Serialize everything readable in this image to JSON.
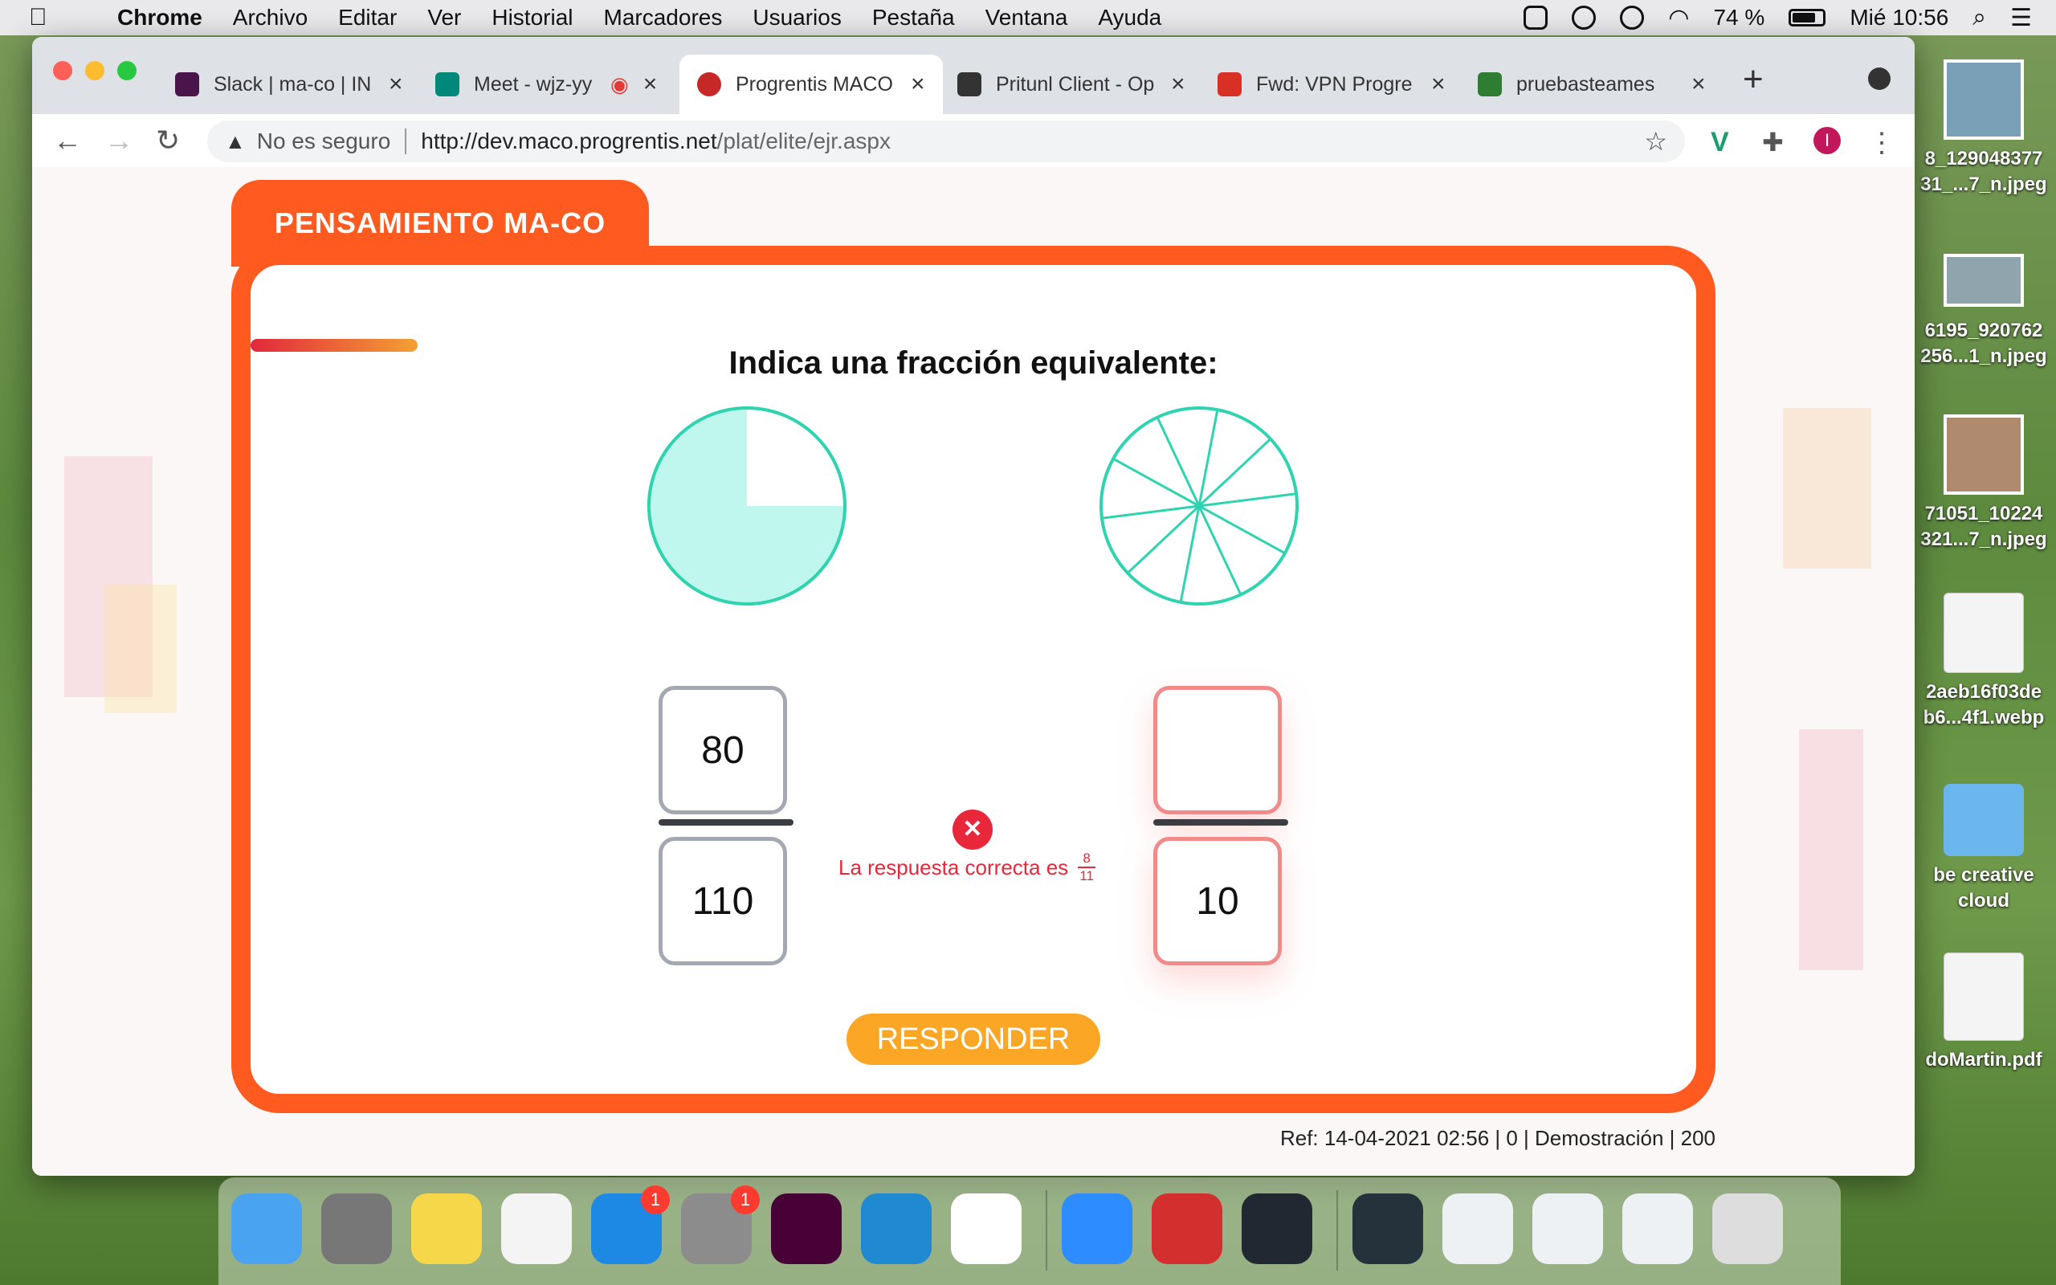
{
  "menubar": {
    "app": "Chrome",
    "items": [
      "Archivo",
      "Editar",
      "Ver",
      "Historial",
      "Marcadores",
      "Usuarios",
      "Pestaña",
      "Ventana",
      "Ayuda"
    ],
    "battery": "74 %",
    "clock": "Mié 10:56"
  },
  "desktop": {
    "files": [
      {
        "label1": "8_129048377",
        "label2": "31_...7_n.jpeg",
        "icon": "photo-icon"
      },
      {
        "label1": "",
        "label2": "",
        "icon": "photo-icon"
      },
      {
        "label1": "6195_920762",
        "label2": "256...1_n.jpeg",
        "icon": "photo-icon"
      },
      {
        "label1": "71051_10224",
        "label2": "321...7_n.jpeg",
        "icon": "photo-icon"
      },
      {
        "label1": "2aeb16f03de",
        "label2": "b6...4f1.webp",
        "icon": "preview-icon"
      },
      {
        "label1": "be creative",
        "label2": "cloud",
        "icon": "folder-icon"
      },
      {
        "label1": "doMartin.pdf",
        "label2": "",
        "icon": "pdf-icon"
      }
    ]
  },
  "browser": {
    "tabs": [
      {
        "label": "Slack | ma-co | IN",
        "color": "#4a154b"
      },
      {
        "label": "Meet - wjz-yy",
        "color": "#00897b"
      },
      {
        "label": "Progrentis MACO",
        "color": "#c62828"
      },
      {
        "label": "Pritunl Client - Op",
        "color": "#333333"
      },
      {
        "label": "Fwd: VPN Progre",
        "color": "#d93025"
      },
      {
        "label": "pruebasteames",
        "color": "#2e7d32"
      }
    ],
    "omnibox": {
      "security": "No es seguro",
      "url_host": "http://dev.maco.progrentis.net",
      "url_path": "/plat/elite/ejr.aspx"
    },
    "profile_initial": "I"
  },
  "exercise": {
    "section_title": "PENSAMIENTO MA-CO",
    "question": "Indica una fracción equivalente:",
    "left_fraction": {
      "numerator": "80",
      "denominator": "110"
    },
    "right_fraction": {
      "numerator": "",
      "denominator": "10"
    },
    "feedback_text": "La respuesta correcta es",
    "correct_answer": {
      "numerator": "8",
      "denominator": "11"
    },
    "left_circle_filled_fraction": 0.75,
    "right_circle_segments": 10,
    "submit_label": "RESPONDER",
    "ref": "Ref: 14-04-2021 02:56 | 0 | Demostración | 200"
  },
  "colors": {
    "accent_orange": "#ff5a1f",
    "button_yellow": "#fba624",
    "error_red": "#e8273a",
    "pie_teal": "#2ed3b0",
    "pie_fill": "#bff7ee"
  },
  "dock": {
    "apps": [
      {
        "name": "finder-icon",
        "color": "#4aa3f0",
        "badge": ""
      },
      {
        "name": "launchpad-icon",
        "color": "#777777",
        "badge": ""
      },
      {
        "name": "notes-icon",
        "color": "#f7d74a",
        "badge": ""
      },
      {
        "name": "reminders-icon",
        "color": "#f4f4f4",
        "badge": ""
      },
      {
        "name": "app-store-icon",
        "color": "#1e88e5",
        "badge": "1"
      },
      {
        "name": "system-preferences-icon",
        "color": "#8c8c8c",
        "badge": "1"
      },
      {
        "name": "adobe-xd-icon",
        "color": "#470137",
        "badge": ""
      },
      {
        "name": "vscode-icon",
        "color": "#1f8ad2",
        "badge": ""
      },
      {
        "name": "chrome-icon",
        "color": "#ffffff",
        "badge": ""
      },
      {
        "name": "zoom-icon",
        "color": "#2d8cff",
        "badge": ""
      },
      {
        "name": "acrobat-icon",
        "color": "#d32f2f",
        "badge": ""
      },
      {
        "name": "pritunl-icon",
        "color": "#222831",
        "badge": ""
      },
      {
        "name": "window-thumb-1",
        "color": "#26323b",
        "badge": ""
      },
      {
        "name": "window-thumb-2",
        "color": "#eef1f4",
        "badge": ""
      },
      {
        "name": "window-thumb-3",
        "color": "#eef1f4",
        "badge": ""
      },
      {
        "name": "window-thumb-4",
        "color": "#eef1f4",
        "badge": ""
      },
      {
        "name": "trash-icon",
        "color": "#dddddd",
        "badge": ""
      }
    ]
  }
}
